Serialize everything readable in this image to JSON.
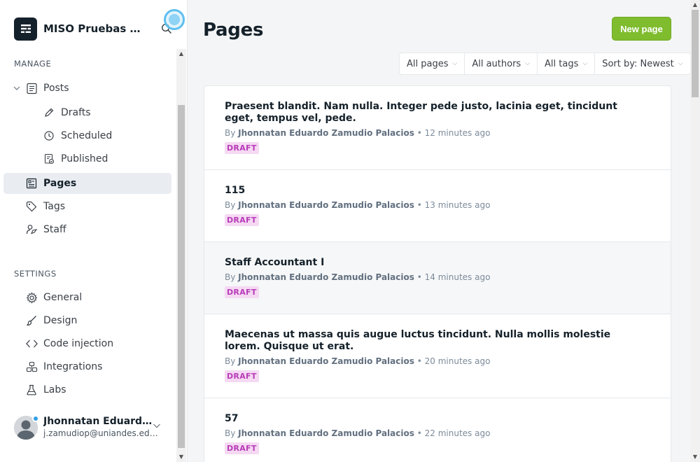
{
  "brand": {
    "title": "MISO Pruebas Automatizadas",
    "logo_icon": "ghost-logo-icon",
    "search_icon": "search-icon"
  },
  "sidebar": {
    "manage_label": "MANAGE",
    "settings_label": "SETTINGS",
    "manage_items": [
      {
        "label": "Posts",
        "icon": "posts-icon"
      },
      {
        "label": "Drafts",
        "icon": "pencil-icon"
      },
      {
        "label": "Scheduled",
        "icon": "clock-icon"
      },
      {
        "label": "Published",
        "icon": "published-icon"
      },
      {
        "label": "Pages",
        "icon": "pages-icon",
        "active": true
      },
      {
        "label": "Tags",
        "icon": "tag-icon"
      },
      {
        "label": "Staff",
        "icon": "staff-icon"
      }
    ],
    "settings_items": [
      {
        "label": "General",
        "icon": "gear-icon"
      },
      {
        "label": "Design",
        "icon": "brush-icon"
      },
      {
        "label": "Code injection",
        "icon": "code-icon"
      },
      {
        "label": "Integrations",
        "icon": "integrations-icon"
      },
      {
        "label": "Labs",
        "icon": "flask-icon"
      }
    ],
    "user": {
      "name": "Jhonnatan Eduardo Zamudio Palacios",
      "email": "j.zamudiop@uniandes.edu.co"
    }
  },
  "main": {
    "title": "Pages",
    "new_button": "New page",
    "filters": [
      "All pages",
      "All authors",
      "All tags",
      "Sort by: Newest"
    ],
    "rows": [
      {
        "title": "Praesent blandit. Nam nulla. Integer pede justo, lacinia eget, tincidunt eget, tempus vel, pede.",
        "by": "By",
        "author": "Jhonnatan Eduardo Zamudio Palacios",
        "sep": "•",
        "time": "12 minutes ago",
        "status": "DRAFT"
      },
      {
        "title": "115",
        "by": "By",
        "author": "Jhonnatan Eduardo Zamudio Palacios",
        "sep": "•",
        "time": "13 minutes ago",
        "status": "DRAFT"
      },
      {
        "title": "Staff Accountant I",
        "by": "By",
        "author": "Jhonnatan Eduardo Zamudio Palacios",
        "sep": "•",
        "time": "14 minutes ago",
        "status": "DRAFT"
      },
      {
        "title": "Maecenas ut massa quis augue luctus tincidunt. Nulla mollis molestie lorem. Quisque ut erat.",
        "by": "By",
        "author": "Jhonnatan Eduardo Zamudio Palacios",
        "sep": "•",
        "time": "20 minutes ago",
        "status": "DRAFT"
      },
      {
        "title": "57",
        "by": "By",
        "author": "Jhonnatan Eduardo Zamudio Palacios",
        "sep": "•",
        "time": "22 minutes ago",
        "status": "DRAFT"
      }
    ]
  },
  "colors": {
    "accent_green": "#7fbc2e",
    "draft_badge": "#b83cb8",
    "active_nav": "#e9ecf1"
  }
}
